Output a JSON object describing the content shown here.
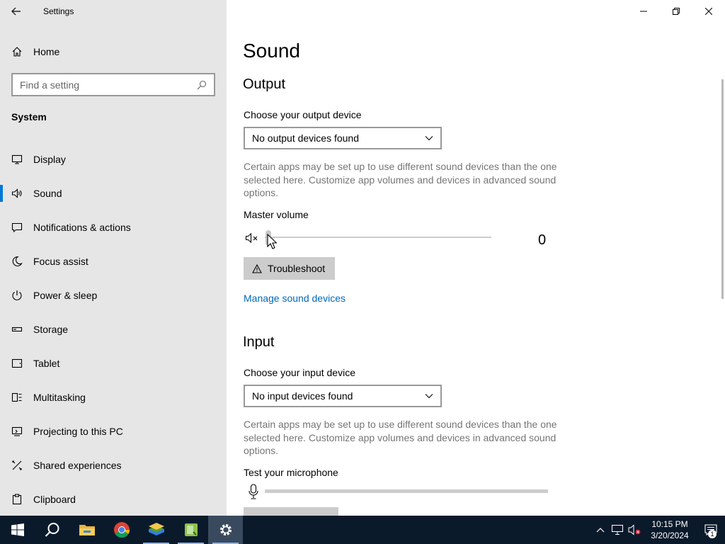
{
  "window": {
    "title": "Settings"
  },
  "sidebar": {
    "home_label": "Home",
    "search_placeholder": "Find a setting",
    "group_title": "System",
    "items": [
      {
        "label": "Display",
        "icon": "display-icon",
        "active": false
      },
      {
        "label": "Sound",
        "icon": "speaker-icon",
        "active": true
      },
      {
        "label": "Notifications & actions",
        "icon": "notifications-icon",
        "active": false
      },
      {
        "label": "Focus assist",
        "icon": "moon-icon",
        "active": false
      },
      {
        "label": "Power & sleep",
        "icon": "power-icon",
        "active": false
      },
      {
        "label": "Storage",
        "icon": "storage-icon",
        "active": false
      },
      {
        "label": "Tablet",
        "icon": "tablet-icon",
        "active": false
      },
      {
        "label": "Multitasking",
        "icon": "multitasking-icon",
        "active": false
      },
      {
        "label": "Projecting to this PC",
        "icon": "projecting-icon",
        "active": false
      },
      {
        "label": "Shared experiences",
        "icon": "shared-experiences-icon",
        "active": false
      },
      {
        "label": "Clipboard",
        "icon": "clipboard-icon",
        "active": false
      }
    ]
  },
  "main": {
    "page_title": "Sound",
    "output": {
      "title": "Output",
      "device_label": "Choose your output device",
      "device_value": "No output devices found",
      "description": "Certain apps may be set up to use different sound devices than the one selected here. Customize app volumes and devices in advanced sound options.",
      "volume_label": "Master volume",
      "volume_value": "0",
      "troubleshoot_label": "Troubleshoot",
      "manage_link": "Manage sound devices"
    },
    "input": {
      "title": "Input",
      "device_label": "Choose your input device",
      "device_value": "No input devices found",
      "description": "Certain apps may be set up to use different sound devices than the one selected here. Customize app volumes and devices in advanced sound options.",
      "mic_label": "Test your microphone"
    }
  },
  "taskbar": {
    "time": "10:15 PM",
    "date": "3/20/2024",
    "notification_count": "1"
  },
  "colors": {
    "accent": "#0078d7",
    "link": "#0067b8",
    "sidebar_bg": "#e6e6e6",
    "taskbar_bg": "#0b1a2b"
  }
}
